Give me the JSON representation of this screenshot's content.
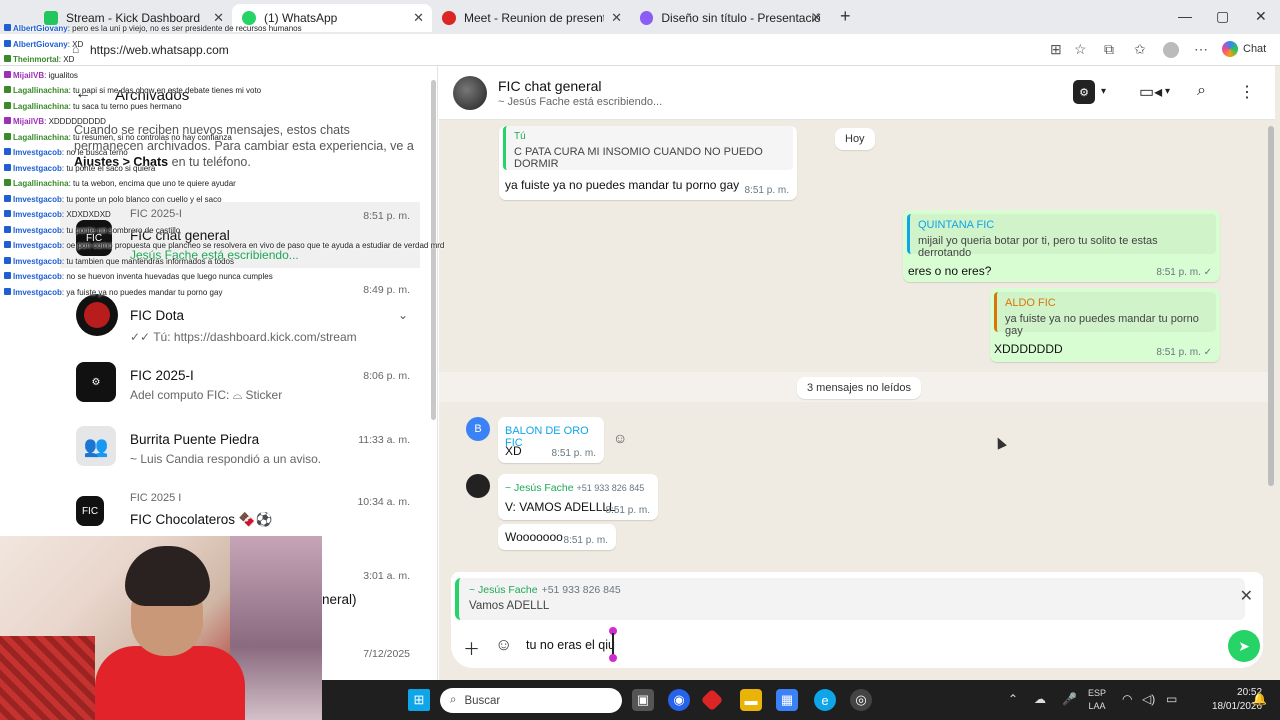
{
  "browser": {
    "tabs": [
      {
        "label": "Stream - Kick Dashboard",
        "color": "#22c55e"
      },
      {
        "label": "(1) WhatsApp",
        "color": "#25d366"
      },
      {
        "label": "Meet - Reunion de presentaci",
        "color": "#dc2626"
      },
      {
        "label": "Diseño sin título - Presentación",
        "color": "#8b5cf6"
      }
    ],
    "url": "https://web.whatsapp.com",
    "copilot_label": "Chat"
  },
  "archived": {
    "title": "Archivados",
    "note_prefix": "Cuando se reciben nuevos mensajes, estos chats permanecen archivados. Para cambiar esta experiencia, ve a ",
    "note_bold": "Ajustes > Chats",
    "note_suffix": " en tu teléfono."
  },
  "chats": [
    {
      "name": "FIC chat general",
      "sub": "Jesús Fache está escribiendo...",
      "time": "8:51 p. m.",
      "community": "FIC 2025-I"
    },
    {
      "name": "FIC Dota",
      "sub": "✓✓ Tú: https://dashboard.kick.com/stream",
      "time": "8:49 p. m."
    },
    {
      "name": "FIC 2025-I",
      "sub": "Adel computo FIC: ⌓ Sticker",
      "time": "8:06 p. m."
    },
    {
      "name": "Burrita Puente Piedra",
      "sub": "~ Luis Candia respondió a un aviso.",
      "time": "11:33 a. m."
    },
    {
      "name": "FIC Chocolateros 🍫⚽",
      "sub": "",
      "time": "10:34 a. m.",
      "community": "FIC 2025 I"
    },
    {
      "name": "neral)",
      "sub": "",
      "time": "3:01 a. m."
    },
    {
      "name": "",
      "sub": "",
      "time": "7/12/2025"
    }
  ],
  "chat_header": {
    "name": "FIC chat general",
    "status": "~ Jesús Fache está escribiendo..."
  },
  "messages": {
    "quoted_you": {
      "label": "Tú",
      "text": "C PATA CURA MI INSOMIO CUANDO NO PUEDO DORMIR",
      "reply": "ya fuiste ya no puedes mandar tu porno gay",
      "time": "8:51 p. m."
    },
    "day_pill": "Hoy",
    "quintana": {
      "sender": "QUINTANA FIC",
      "quote": "mijail yo queria botar por ti, pero tu solito te estas derrotando",
      "text": "eres o no eres?",
      "time": "8:51 p. m. ✓"
    },
    "aldo": {
      "sender": "ALDO FIC",
      "quote": "ya fuiste ya no puedes mandar tu porno gay",
      "text": "XDDDDDDD",
      "time": "8:51 p. m. ✓"
    },
    "unread": "3 mensajes no leídos",
    "balon": {
      "initial": "B",
      "sender": "BALON DE ORO FIC",
      "text": "XD",
      "time": "8:51 p. m."
    },
    "jesus_1": {
      "sender": "~ Jesús Fache",
      "phone": "+51 933 826 845",
      "text": "V: VAMOS ADELLLL",
      "time": "8:51 p. m."
    },
    "jesus_2": {
      "text": "Wooooooo",
      "time": "8:51 p. m."
    }
  },
  "reply": {
    "sender": "~ Jesús Fache",
    "phone": "+51 933 826 845",
    "text": "Vamos ADELLL"
  },
  "composer": {
    "text": "tu no eras el qiu"
  },
  "stream_overlay": [
    {
      "user": "AlbertGiovany",
      "msg": ": pero es la uni p viejo, no es ser presidente de recursos humanos",
      "color": "blue"
    },
    {
      "user": "AlbertGiovany",
      "msg": ": XD",
      "color": "blue"
    },
    {
      "user": "Theinmortal",
      "msg": ": XD",
      "color": "green"
    },
    {
      "user": "MijailVB",
      "msg": ": igualitos",
      "color": "purple"
    },
    {
      "user": "Lagallinachina",
      "msg": ": tu papi si me das chow en este debate tienes mi voto",
      "color": "green"
    },
    {
      "user": "Lagallinachina",
      "msg": ": tu saca tu terno pues hermano",
      "color": "green"
    },
    {
      "user": "MijailVB",
      "msg": ": XDDDDDDDDD",
      "color": "purple"
    },
    {
      "user": "Lagallinachina",
      "msg": ": tu resumen, si no controlas no hay confianza",
      "color": "green"
    },
    {
      "user": "Imvestgacob",
      "msg": ": no le busca terno",
      "color": "blue"
    },
    {
      "user": "Imvestgacob",
      "msg": ": tu ponte el saco si quiera",
      "color": "blue"
    },
    {
      "user": "Lagallinachina",
      "msg": ": tu ta webon, encima que uno te quiere ayudar",
      "color": "green"
    },
    {
      "user": "Imvestgacob",
      "msg": ": tu ponte un polo blanco con cuello y el saco",
      "color": "blue"
    },
    {
      "user": "Imvestgacob",
      "msg": ": XDXDXDXD",
      "color": "blue"
    },
    {
      "user": "Imvestgacob",
      "msg": ": tu ponte un sombrero de castillo",
      "color": "blue"
    },
    {
      "user": "Imvestgacob",
      "msg": ": oe pon como propuesta que plancheo se resolvera en vivo de paso que te ayuda a estudiar de verdad mrd",
      "color": "blue"
    },
    {
      "user": "Imvestgacob",
      "msg": ": tu tambien que mantendras informados a todos",
      "color": "blue"
    },
    {
      "user": "Imvestgacob",
      "msg": ": no se huevon inventa huevadas que luego nunca cumples",
      "color": "blue"
    },
    {
      "user": "Imvestgacob",
      "msg": ": ya fuiste ya no puedes mandar tu porno gay",
      "color": "blue"
    }
  ],
  "taskbar": {
    "search_placeholder": "Buscar",
    "lang_line1": "ESP",
    "lang_line2": "LAA",
    "time": "20:52",
    "date": "18/01/2026"
  }
}
